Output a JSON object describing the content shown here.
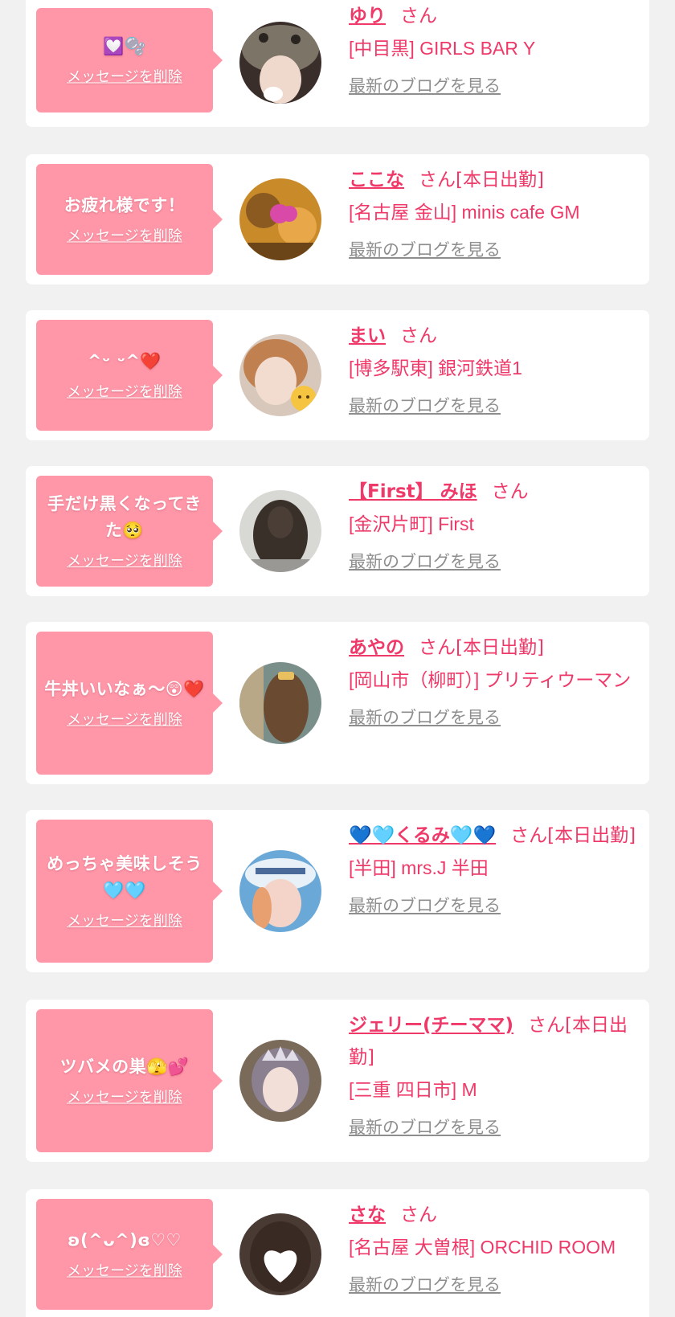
{
  "delete_label": "メッセージを削除",
  "blog_label": "最新のブログを見る",
  "honorific": "さん",
  "colors": {
    "page_bg": "#f1f1f1",
    "card_bg": "#ffffff",
    "bubble_bg": "#ff97a8",
    "accent": "#ee3969",
    "link_gray": "#8e8e8e"
  },
  "entries": [
    {
      "message": "💟🫧",
      "name": "ゆり",
      "status": "さん",
      "shop": "[中目黒] GIRLS BAR Y",
      "avatar_icon": "cat-hat-photo-avatar"
    },
    {
      "message": "お疲れ様です！",
      "name": "ここな",
      "status": "さん[本日出勤]",
      "shop": "[名古屋 金山] minis cafe GM",
      "avatar_icon": "cafe-photo-avatar"
    },
    {
      "message": "^ᵕ ᵕ^❤️",
      "name": "まい",
      "status": "さん",
      "shop": "[博多駅東] 銀河鉄道1",
      "avatar_icon": "girl-cat-emoji-avatar"
    },
    {
      "message": "手だけ黒くなってきた🥺",
      "name": "【First】 みほ",
      "status": "さん",
      "shop": "[金沢片町] First",
      "avatar_icon": "curly-hair-avatar"
    },
    {
      "message": "牛丼いいなぁ〜😲❤️",
      "name": "あやの",
      "status": "さん[本日出勤]",
      "shop": "[岡山市（柳町）] プリティウーマン",
      "avatar_icon": "hair-clip-avatar"
    },
    {
      "message": "めっちゃ美味しそう🩵🩵",
      "name": "💙🩵くるみ🩵💙",
      "status": "さん[本日出勤]",
      "shop": "[半田] mrs.J 半田",
      "avatar_icon": "cap-girl-avatar"
    },
    {
      "message": "ツバメの巣🫣💕",
      "name": "ジェリー(チーママ)",
      "status": "さん[本日出勤]",
      "shop": "[三重 四日市] M",
      "avatar_icon": "tiara-girl-avatar"
    },
    {
      "message": "ʚ(^ᴗ^)ɞ♡♡",
      "name": "さな",
      "status": "さん",
      "shop": "[名古屋 大曽根] ORCHID ROOM",
      "avatar_icon": "heart-face-avatar"
    }
  ]
}
